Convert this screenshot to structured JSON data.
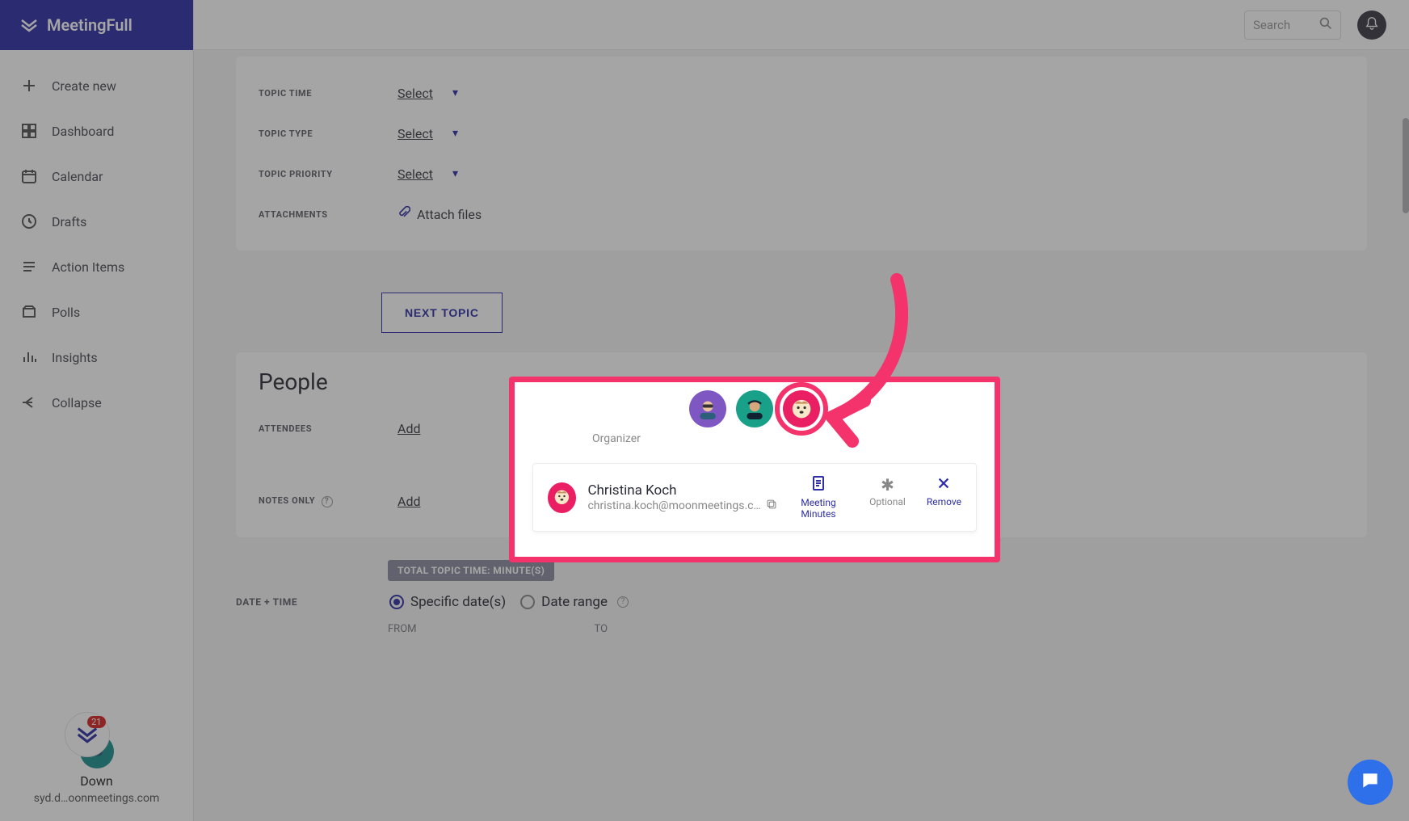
{
  "brand": {
    "name": "MeetingFull"
  },
  "search": {
    "placeholder": "Search"
  },
  "nav": {
    "create": "Create new",
    "dashboard": "Dashboard",
    "calendar": "Calendar",
    "drafts": "Drafts",
    "action_items": "Action Items",
    "polls": "Polls",
    "insights": "Insights",
    "collapse": "Collapse"
  },
  "user": {
    "name": "Down",
    "email": "syd.d…oonmeetings.com",
    "badge_count": "21"
  },
  "topic": {
    "time_label": "TOPIC TIME",
    "type_label": "TOPIC TYPE",
    "priority_label": "TOPIC PRIORITY",
    "attachments_label": "ATTACHMENTS",
    "select": "Select",
    "attach_files": "Attach files",
    "next_topic": "NEXT TOPIC"
  },
  "people": {
    "title": "People",
    "attendees_label": "ATTENDEES",
    "notes_only_label": "NOTES ONLY",
    "add": "Add",
    "organizer_label": "Organizer"
  },
  "person_card": {
    "name": "Christina Koch",
    "email": "christina.koch@moonmeetings.c…",
    "meeting_minutes": "Meeting Minutes",
    "optional": "Optional",
    "remove": "Remove"
  },
  "datetime": {
    "date_time_label": "DATE + TIME",
    "total_chip": "TOTAL TOPIC TIME: MINUTE(S)",
    "specific": "Specific date(s)",
    "range": "Date range",
    "from": "FROM",
    "to": "TO"
  }
}
